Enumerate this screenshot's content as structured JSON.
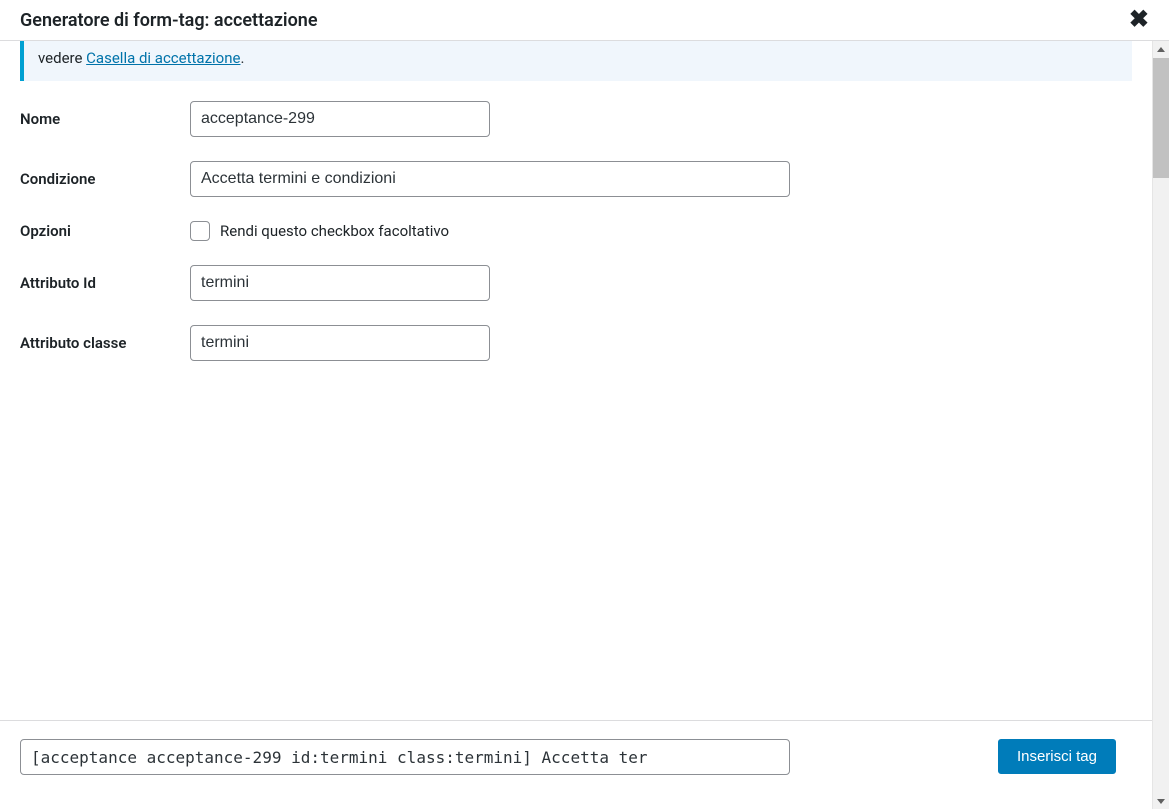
{
  "dialog": {
    "title": "Generatore di form-tag: accettazione"
  },
  "info": {
    "prefix": "vedere ",
    "link": "Casella di accettazione",
    "suffix": "."
  },
  "form": {
    "name": {
      "label": "Nome",
      "value": "acceptance-299"
    },
    "condition": {
      "label": "Condizione",
      "value": "Accetta termini e condizioni"
    },
    "options": {
      "label": "Opzioni",
      "checkbox_label": "Rendi questo checkbox facoltativo"
    },
    "id_attr": {
      "label": "Attributo Id",
      "value": "termini"
    },
    "class_attr": {
      "label": "Attributo classe",
      "value": "termini"
    }
  },
  "footer": {
    "tag_output": "[acceptance acceptance-299 id:termini class:termini] Accetta ter",
    "insert_label": "Inserisci tag"
  }
}
